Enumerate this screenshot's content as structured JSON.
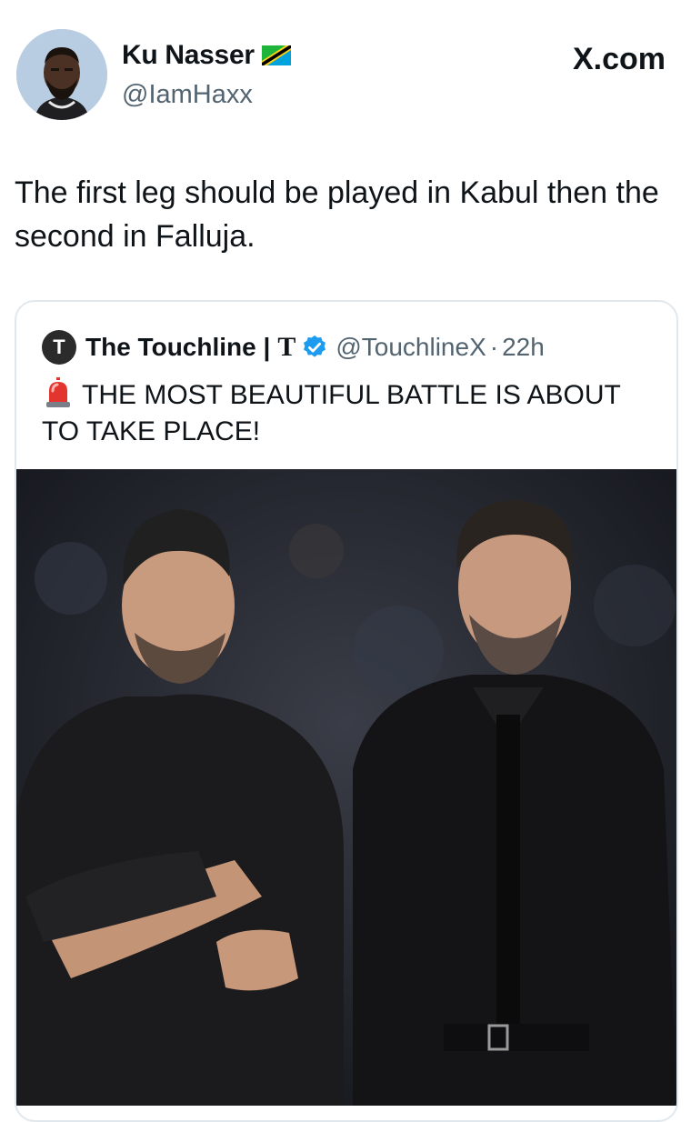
{
  "header": {
    "author_name": "Ku Nasser",
    "author_handle": "@IamHaxx",
    "site_label": "X.com",
    "flag_icon": "tanzania-flag-icon"
  },
  "tweet": {
    "text": "The first leg should be played in Kabul then the second in Falluja."
  },
  "quote": {
    "avatar_letter": "T",
    "name": "The Touchline |",
    "name_suffix": "T",
    "handle": "@TouchlineX",
    "separator": "·",
    "time": "22h",
    "text": "THE MOST BEAUTIFUL BATTLE IS ABOUT TO TAKE PLACE!",
    "emoji_icon": "police-siren-icon"
  },
  "colors": {
    "text": "#0f1419",
    "muted": "#536471",
    "verified": "#1d9bf0",
    "border": "#e1e8ed"
  }
}
